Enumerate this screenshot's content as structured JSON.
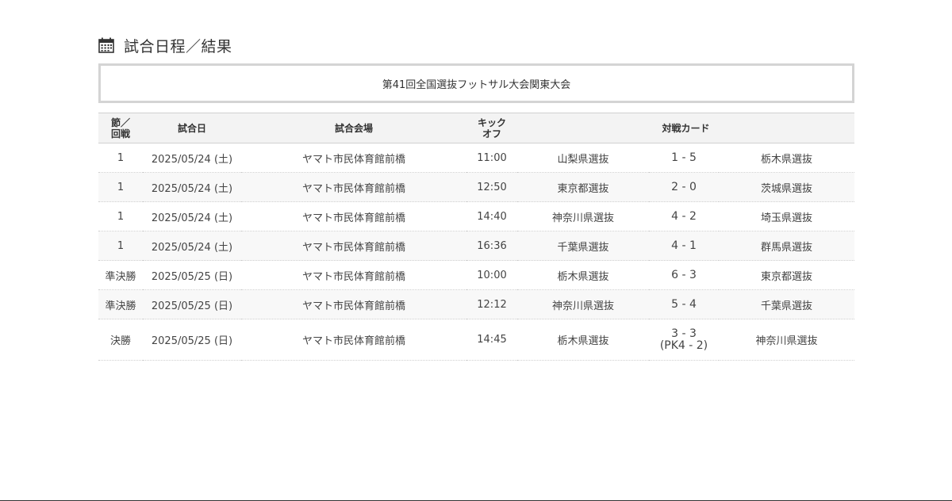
{
  "section": {
    "title": "試合日程／結果",
    "icon": "calendar-icon"
  },
  "tournament": {
    "name": "第41回全国選抜フットサル大会関東大会"
  },
  "table": {
    "headers": {
      "round_line1": "節／",
      "round_line2": "回戦",
      "date": "試合日",
      "venue": "試合会場",
      "kickoff_line1": "キック",
      "kickoff_line2": "オフ",
      "matchup": "対戦カード"
    },
    "rows": [
      {
        "round": "1",
        "date": "2025/05/24 (土)",
        "venue": "ヤマト市民体育館前橋",
        "kickoff": "11:00",
        "home": "山梨県選抜",
        "score": "1 - 5",
        "pk": "",
        "away": "栃木県選抜"
      },
      {
        "round": "1",
        "date": "2025/05/24 (土)",
        "venue": "ヤマト市民体育館前橋",
        "kickoff": "12:50",
        "home": "東京都選抜",
        "score": "2 - 0",
        "pk": "",
        "away": "茨城県選抜"
      },
      {
        "round": "1",
        "date": "2025/05/24 (土)",
        "venue": "ヤマト市民体育館前橋",
        "kickoff": "14:40",
        "home": "神奈川県選抜",
        "score": "4 - 2",
        "pk": "",
        "away": "埼玉県選抜"
      },
      {
        "round": "1",
        "date": "2025/05/24 (土)",
        "venue": "ヤマト市民体育館前橋",
        "kickoff": "16:36",
        "home": "千葉県選抜",
        "score": "4 - 1",
        "pk": "",
        "away": "群馬県選抜"
      },
      {
        "round": "準決勝",
        "date": "2025/05/25 (日)",
        "venue": "ヤマト市民体育館前橋",
        "kickoff": "10:00",
        "home": "栃木県選抜",
        "score": "6 - 3",
        "pk": "",
        "away": "東京都選抜"
      },
      {
        "round": "準決勝",
        "date": "2025/05/25 (日)",
        "venue": "ヤマト市民体育館前橋",
        "kickoff": "12:12",
        "home": "神奈川県選抜",
        "score": "5 - 4",
        "pk": "",
        "away": "千葉県選抜"
      },
      {
        "round": "決勝",
        "date": "2025/05/25 (日)",
        "venue": "ヤマト市民体育館前橋",
        "kickoff": "14:45",
        "home": "栃木県選抜",
        "score": "3 - 3",
        "pk": "(PK4 - 2)",
        "away": "神奈川県選抜"
      }
    ]
  },
  "colors": {
    "score_link": "#2a4a7a",
    "header_bg": "#f3f3f3",
    "box_border": "#d4d4d4"
  }
}
